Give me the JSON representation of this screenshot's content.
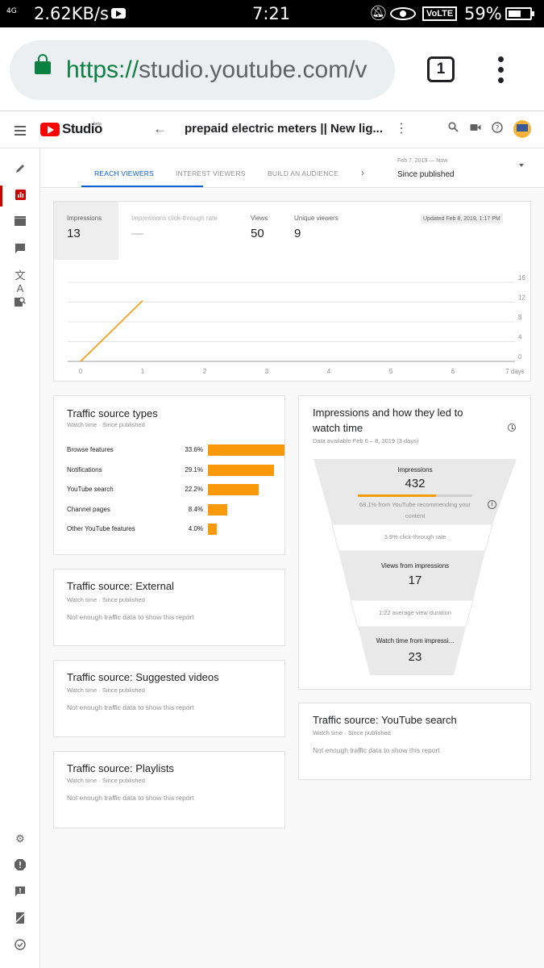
{
  "status_bar": {
    "signal": "4G",
    "speed": "2.62KB/s",
    "time": "7:21",
    "volte": "VoLTE",
    "battery": "59%"
  },
  "browser": {
    "url_scheme": "https://",
    "url_rest": "studio.youtube.com/v",
    "tab_count": "1"
  },
  "studio_header": {
    "logo_text": "Studio",
    "beta_text": "beta",
    "video_title": "prepaid electric meters || New lig..."
  },
  "tabs": {
    "items": [
      "REACH VIEWERS",
      "INTEREST VIEWERS",
      "BUILD AN AUDIENCE"
    ],
    "active": "REACH VIEWERS",
    "date_range": "Feb 7, 2019 — Now",
    "date_label": "Since published"
  },
  "overview": {
    "metrics": [
      {
        "label": "Impressions",
        "value": "13"
      },
      {
        "label": "Impressions click-through rate",
        "value": "—"
      },
      {
        "label": "Views",
        "value": "50"
      },
      {
        "label": "Unique viewers",
        "value": "9"
      }
    ],
    "updated": "Updated Feb 8, 2019, 1:17 PM"
  },
  "chart_data": {
    "type": "line",
    "series": [
      {
        "x": [
          0,
          1
        ],
        "values": [
          0,
          12.3
        ]
      }
    ],
    "x_ticks": [
      "0",
      "1",
      "2",
      "3",
      "4",
      "5",
      "6",
      "7 days"
    ],
    "y_ticks": [
      "16",
      "12",
      "8",
      "4",
      "0"
    ],
    "xlim": [
      0,
      7
    ],
    "ylim": [
      0,
      16
    ],
    "line_color": "#fa9a0a",
    "grid": true
  },
  "traffic_types": {
    "title": "Traffic source types",
    "subtitle": "Watch time · Since published",
    "rows": [
      {
        "label": "Browse features",
        "pct": "33.6%",
        "value": 33.6
      },
      {
        "label": "Notifications",
        "pct": "29.1%",
        "value": 29.1
      },
      {
        "label": "YouTube search",
        "pct": "22.2%",
        "value": 22.2
      },
      {
        "label": "Channel pages",
        "pct": "8.4%",
        "value": 8.4
      },
      {
        "label": "Other YouTube features",
        "pct": "4.0%",
        "value": 4.0
      }
    ],
    "bar_color": "#fa9a0a"
  },
  "external": {
    "title": "Traffic source: External",
    "subtitle": "Watch time · Since published",
    "empty": "Not enough traffic data to show this report"
  },
  "suggested": {
    "title": "Traffic source: Suggested videos",
    "subtitle": "Watch time · Since published",
    "empty": "Not enough traffic data to show this report"
  },
  "playlists": {
    "title": "Traffic source: Playlists",
    "subtitle": "Watch time · Since published",
    "empty": "Not enough traffic data to show this report"
  },
  "funnel": {
    "title_line1": "Impressions and how they led to",
    "title_line2": "watch time",
    "subtitle": "Data available Feb 6 – 8, 2019 (3 days)",
    "impressions_label": "Impressions",
    "impressions_value": "432",
    "rec_line1": "68.1% from YouTube recommending your",
    "rec_line2": "content",
    "rec_fraction": 0.681,
    "ctr": "3.9% click-through rate",
    "views_label": "Views from impressions",
    "views_value": "17",
    "avd": "1:22 average view duration",
    "watch_label": "Watch time from impressi...",
    "watch_value": "23"
  },
  "yt_search": {
    "title": "Traffic source: YouTube search",
    "subtitle": "Watch time · Since published",
    "empty": "Not enough traffic data to show this report"
  }
}
